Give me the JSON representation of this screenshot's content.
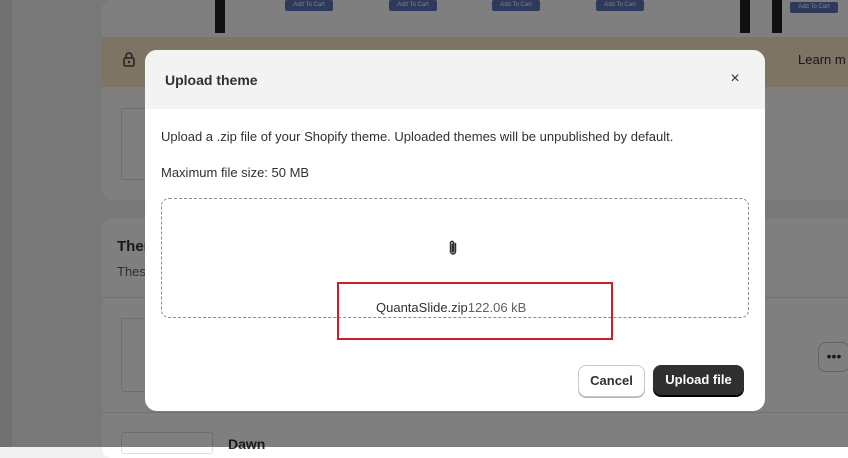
{
  "background": {
    "preview_buttons": [
      "Add To Cart",
      "Add To Cart",
      "Add To Cart",
      "Add To Cart",
      "Add To Cart"
    ],
    "banner": {
      "icon": "lock-icon",
      "link": "Learn m"
    },
    "themes": {
      "title": "Ther",
      "subtitle": "Thes",
      "more_label": "•••",
      "row2_name": "Dawn"
    }
  },
  "modal": {
    "title": "Upload theme",
    "close_label": "×",
    "description": "Upload a .zip file of your Shopify theme. Uploaded themes will be unpublished by default.",
    "max_size": "Maximum file size: 50 MB",
    "dropzone": {
      "icon": "paperclip-icon",
      "file_name": "QuantaSlide.zip",
      "file_size": "122.06 kB"
    },
    "cancel_label": "Cancel",
    "upload_label": "Upload file"
  },
  "colors": {
    "primary_button": "#303030",
    "highlight": "#c8202a",
    "banner": "#fbe9c9"
  }
}
